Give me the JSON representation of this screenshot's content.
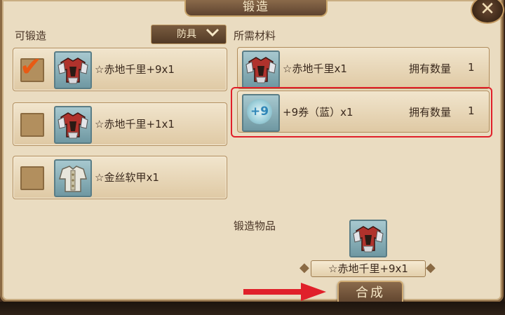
{
  "window": {
    "title": "锻造",
    "close_glyph": "✕"
  },
  "left_panel": {
    "label": "可锻造",
    "filter": {
      "selected": "防具",
      "chevron_icon": "chevron-down-icon"
    },
    "items": [
      {
        "name": "☆赤地千里+9x1",
        "checked": true,
        "icon": "red-armor-icon"
      },
      {
        "name": "☆赤地千里+1x1",
        "checked": false,
        "icon": "red-armor-icon"
      },
      {
        "name": "☆金丝软甲x1",
        "checked": false,
        "icon": "silk-armor-icon"
      }
    ]
  },
  "right_panel": {
    "label": "所需材料",
    "materials": [
      {
        "name": "☆赤地千里x1",
        "own_label": "拥有数量",
        "own_value": "1",
        "icon": "red-armor-icon"
      },
      {
        "name": "+9券（蓝）x1",
        "own_label": "拥有数量",
        "own_value": "1",
        "icon": "voucher-icon",
        "badge": "+9"
      }
    ],
    "result_label": "锻造物品",
    "result_name": "☆赤地千里+9x1",
    "craft_button": "合成"
  },
  "colors": {
    "highlight": "#e0202a",
    "checkmark": "#e85a14",
    "arrow": "#e0202a"
  }
}
